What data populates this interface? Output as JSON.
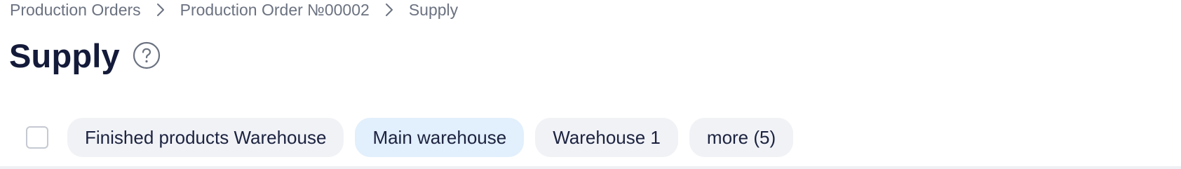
{
  "breadcrumb": {
    "items": [
      {
        "label": "Production Orders"
      },
      {
        "label": "Production Order №00002"
      },
      {
        "label": "Supply"
      }
    ]
  },
  "header": {
    "title": "Supply",
    "help_icon": "question-circle-icon"
  },
  "filters": {
    "select_all_checked": false,
    "chips": [
      {
        "label": "Finished products Warehouse",
        "active": false
      },
      {
        "label": "Main warehouse",
        "active": true
      },
      {
        "label": "Warehouse 1",
        "active": false
      },
      {
        "label": "more (5)",
        "active": false
      }
    ]
  },
  "colors": {
    "title": "#141b3a",
    "breadcrumb": "#6b7280",
    "chip_bg": "#f1f2f6",
    "chip_active_bg": "#e2effc"
  }
}
